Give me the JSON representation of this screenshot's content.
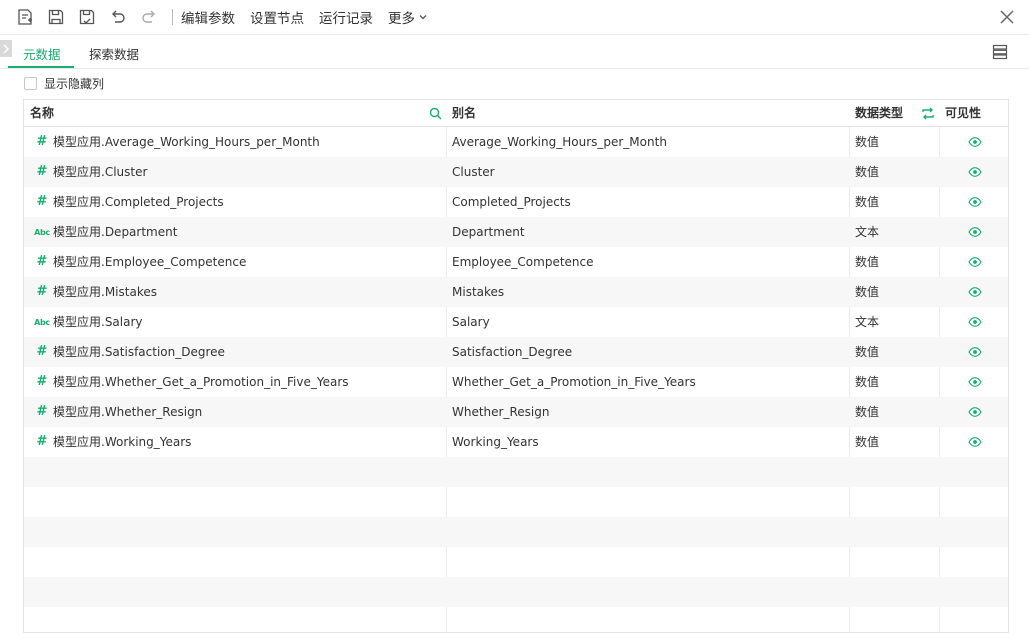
{
  "toolbar": {
    "icons": [
      "new-node-icon",
      "save-icon",
      "save-as-icon",
      "undo-icon",
      "redo-icon"
    ],
    "menus": [
      "编辑参数",
      "设置节点",
      "运行记录"
    ],
    "more_label": "更多"
  },
  "tabs": {
    "items": [
      "元数据",
      "探索数据"
    ],
    "active": "元数据"
  },
  "show_hidden_label": "显示隐藏列",
  "table": {
    "headers": {
      "name": "名称",
      "alias": "别名",
      "type": "数据类型",
      "visibility": "可见性"
    },
    "rows": [
      {
        "icon": "#",
        "name": "模型应用.Average_Working_Hours_per_Month",
        "alias": "Average_Working_Hours_per_Month",
        "type": "数值"
      },
      {
        "icon": "#",
        "name": "模型应用.Cluster",
        "alias": "Cluster",
        "type": "数值"
      },
      {
        "icon": "#",
        "name": "模型应用.Completed_Projects",
        "alias": "Completed_Projects",
        "type": "数值"
      },
      {
        "icon": "Abc",
        "name": "模型应用.Department",
        "alias": "Department",
        "type": "文本"
      },
      {
        "icon": "#",
        "name": "模型应用.Employee_Competence",
        "alias": "Employee_Competence",
        "type": "数值"
      },
      {
        "icon": "#",
        "name": "模型应用.Mistakes",
        "alias": "Mistakes",
        "type": "数值"
      },
      {
        "icon": "Abc",
        "name": "模型应用.Salary",
        "alias": "Salary",
        "type": "文本"
      },
      {
        "icon": "#",
        "name": "模型应用.Satisfaction_Degree",
        "alias": "Satisfaction_Degree",
        "type": "数值"
      },
      {
        "icon": "#",
        "name": "模型应用.Whether_Get_a_Promotion_in_Five_Years",
        "alias": "Whether_Get_a_Promotion_in_Five_Years",
        "type": "数值"
      },
      {
        "icon": "#",
        "name": "模型应用.Whether_Resign",
        "alias": "Whether_Resign",
        "type": "数值"
      },
      {
        "icon": "#",
        "name": "模型应用.Working_Years",
        "alias": "Working_Years",
        "type": "数值"
      }
    ]
  },
  "colors": {
    "accent": "#1aad6f",
    "row_alt": "#f7f7f7",
    "border": "#e3e3e3"
  }
}
